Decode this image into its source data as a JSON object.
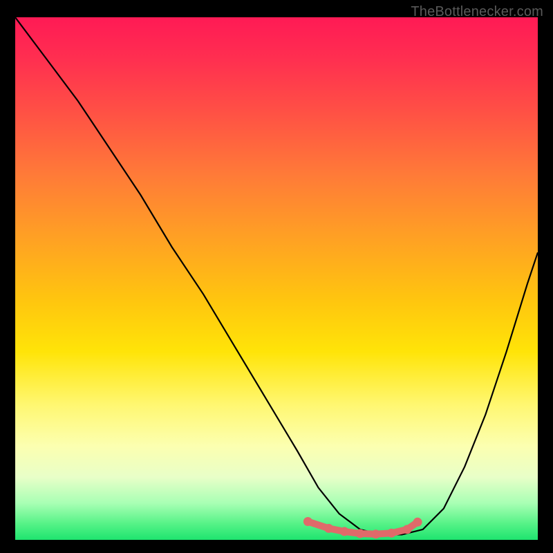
{
  "watermark": "TheBottlenecker.com",
  "chart_data": {
    "type": "line",
    "title": "",
    "xlabel": "",
    "ylabel": "",
    "xlim": [
      0,
      100
    ],
    "ylim": [
      0,
      100
    ],
    "series": [
      {
        "name": "curve",
        "x": [
          0,
          6,
          12,
          18,
          24,
          30,
          36,
          42,
          48,
          54,
          58,
          62,
          66,
          70,
          74,
          78,
          82,
          86,
          90,
          94,
          98,
          100
        ],
        "y": [
          100,
          92,
          84,
          75,
          66,
          56,
          47,
          37,
          27,
          17,
          10,
          5,
          2,
          1,
          1,
          2,
          6,
          14,
          24,
          36,
          49,
          55
        ]
      }
    ],
    "highlight_points": {
      "x": [
        56,
        60,
        63,
        66,
        69,
        72,
        75,
        77
      ],
      "y": [
        3.5,
        2.2,
        1.6,
        1.2,
        1.1,
        1.3,
        2.0,
        3.4
      ]
    },
    "background_gradient": {
      "stops": [
        {
          "pos": 0.0,
          "color": "#ff1a55"
        },
        {
          "pos": 0.3,
          "color": "#ff7a38"
        },
        {
          "pos": 0.54,
          "color": "#ffc50f"
        },
        {
          "pos": 0.82,
          "color": "#fcffb0"
        },
        {
          "pos": 1.0,
          "color": "#1ee46f"
        }
      ]
    }
  }
}
